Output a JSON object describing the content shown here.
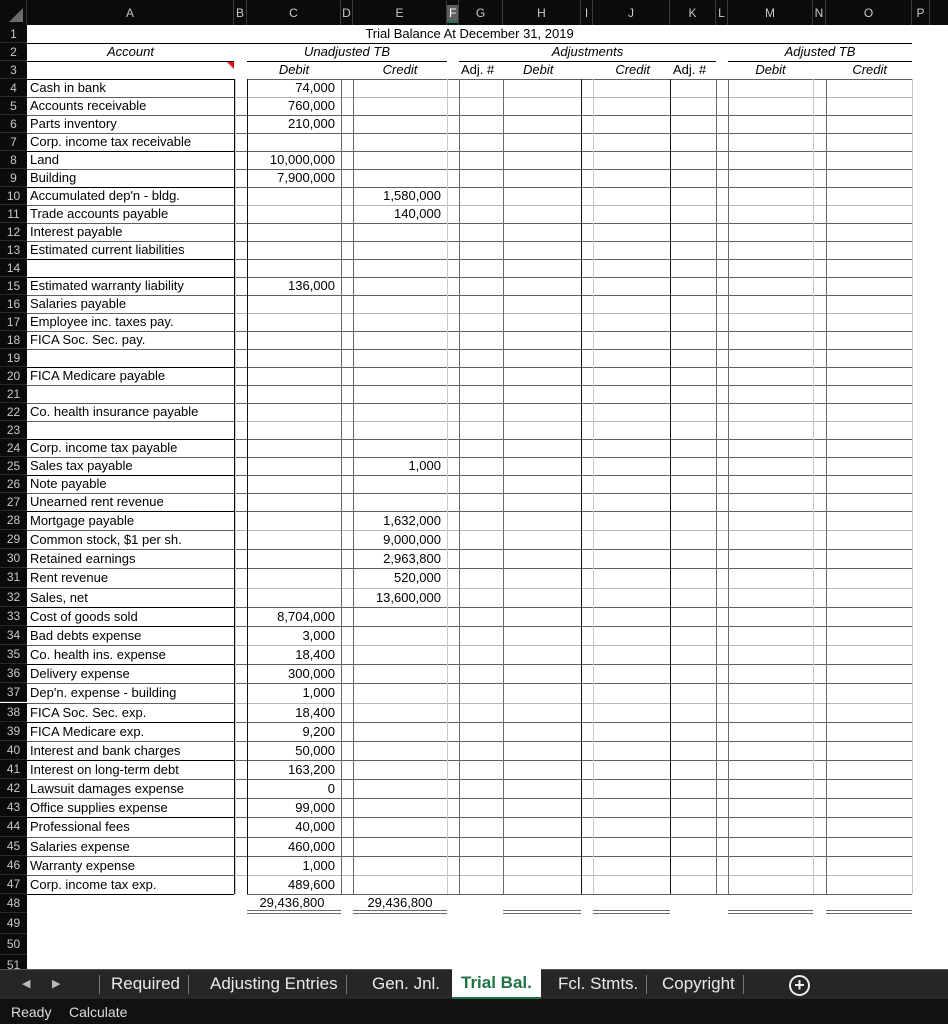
{
  "columns": [
    "A",
    "B",
    "C",
    "D",
    "E",
    "F",
    "G",
    "H",
    "I",
    "J",
    "K",
    "L",
    "M",
    "N",
    "O",
    "P"
  ],
  "selected_column": "F",
  "title": "Trial Balance At December 31, 2019",
  "headers": {
    "account": "Account",
    "unadjusted": "Unadjusted TB",
    "adjustments": "Adjustments",
    "adjusted": "Adjusted TB",
    "debit": "Debit",
    "credit": "Credit",
    "adj_no": "Adj. #"
  },
  "rows": [
    {
      "row": 4,
      "account": "Cash in bank",
      "debit": "74,000",
      "credit": ""
    },
    {
      "row": 5,
      "account": "Accounts receivable",
      "debit": "760,000",
      "credit": ""
    },
    {
      "row": 6,
      "account": "Parts inventory",
      "debit": "210,000",
      "credit": ""
    },
    {
      "row": 7,
      "account": "Corp. income tax receivable",
      "debit": "",
      "credit": ""
    },
    {
      "row": 8,
      "account": "Land",
      "debit": "10,000,000",
      "credit": ""
    },
    {
      "row": 9,
      "account": "Building",
      "debit": "7,900,000",
      "credit": ""
    },
    {
      "row": 10,
      "account": "Accumulated dep'n - bldg.",
      "debit": "",
      "credit": "1,580,000"
    },
    {
      "row": 11,
      "account": "Trade accounts payable",
      "debit": "",
      "credit": "140,000"
    },
    {
      "row": 12,
      "account": "Interest payable",
      "debit": "",
      "credit": ""
    },
    {
      "row": 13,
      "account": "Estimated current liabilities",
      "debit": "",
      "credit": ""
    },
    {
      "row": 14,
      "account": "",
      "debit": "",
      "credit": ""
    },
    {
      "row": 15,
      "account": "Estimated warranty liability",
      "debit": "136,000",
      "credit": ""
    },
    {
      "row": 16,
      "account": "Salaries payable",
      "debit": "",
      "credit": ""
    },
    {
      "row": 17,
      "account": "Employee inc. taxes pay.",
      "debit": "",
      "credit": ""
    },
    {
      "row": 18,
      "account": "FICA Soc. Sec. pay.",
      "debit": "",
      "credit": ""
    },
    {
      "row": 19,
      "account": "",
      "debit": "",
      "credit": ""
    },
    {
      "row": 20,
      "account": "FICA Medicare payable",
      "debit": "",
      "credit": ""
    },
    {
      "row": 21,
      "account": "",
      "debit": "",
      "credit": ""
    },
    {
      "row": 22,
      "account": "Co. health insurance payable",
      "debit": "",
      "credit": ""
    },
    {
      "row": 23,
      "account": "",
      "debit": "",
      "credit": ""
    },
    {
      "row": 24,
      "account": "Corp. income tax payable",
      "debit": "",
      "credit": ""
    },
    {
      "row": 25,
      "account": "Sales tax payable",
      "debit": "",
      "credit": "1,000"
    },
    {
      "row": 26,
      "account": "Note payable",
      "debit": "",
      "credit": ""
    },
    {
      "row": 27,
      "account": "Unearned rent revenue",
      "debit": "",
      "credit": ""
    },
    {
      "row": 28,
      "account": "Mortgage payable",
      "debit": "",
      "credit": "1,632,000"
    },
    {
      "row": 29,
      "account": "Common stock, $1 per sh.",
      "debit": "",
      "credit": "9,000,000"
    },
    {
      "row": 30,
      "account": "Retained earnings",
      "debit": "",
      "credit": "2,963,800"
    },
    {
      "row": 31,
      "account": "Rent revenue",
      "debit": "",
      "credit": "520,000"
    },
    {
      "row": 32,
      "account": "Sales, net",
      "debit": "",
      "credit": "13,600,000"
    },
    {
      "row": 33,
      "account": "Cost of goods sold",
      "debit": "8,704,000",
      "credit": ""
    },
    {
      "row": 34,
      "account": "Bad debts expense",
      "debit": "3,000",
      "credit": ""
    },
    {
      "row": 35,
      "account": "Co.  health ins. expense",
      "debit": "18,400",
      "credit": ""
    },
    {
      "row": 36,
      "account": "Delivery expense",
      "debit": "300,000",
      "credit": ""
    },
    {
      "row": 37,
      "account": "Dep'n. expense - building",
      "debit": "1,000",
      "credit": ""
    },
    {
      "row": 38,
      "account": "FICA Soc. Sec. exp.",
      "debit": "18,400",
      "credit": ""
    },
    {
      "row": 39,
      "account": "FICA Medicare exp.",
      "debit": "9,200",
      "credit": ""
    },
    {
      "row": 40,
      "account": "Interest and bank charges",
      "debit": "50,000",
      "credit": ""
    },
    {
      "row": 41,
      "account": "Interest on long-term debt",
      "debit": "163,200",
      "credit": ""
    },
    {
      "row": 42,
      "account": "Lawsuit damages expense",
      "debit": "0",
      "credit": ""
    },
    {
      "row": 43,
      "account": "Office supplies expense",
      "debit": "99,000",
      "credit": ""
    },
    {
      "row": 44,
      "account": "Professional fees",
      "debit": "40,000",
      "credit": ""
    },
    {
      "row": 45,
      "account": "Salaries expense",
      "debit": "460,000",
      "credit": ""
    },
    {
      "row": 46,
      "account": "Warranty expense",
      "debit": "1,000",
      "credit": ""
    },
    {
      "row": 47,
      "account": "Corp. income tax exp.",
      "debit": "489,600",
      "credit": ""
    }
  ],
  "totals": {
    "row": 48,
    "debit": "29,436,800",
    "credit": "29,436,800"
  },
  "extra_rows": [
    49,
    50,
    51
  ],
  "tabs": [
    {
      "label": "Required",
      "active": false
    },
    {
      "label": "Adjusting Entries",
      "active": false
    },
    {
      "label": "Gen. Jnl.",
      "active": false
    },
    {
      "label": "Trial Bal.",
      "active": true
    },
    {
      "label": "Fcl. Stmts.",
      "active": false
    },
    {
      "label": "Copyright",
      "active": false
    }
  ],
  "tab_nav": {
    "prev": "◀",
    "next": "▶",
    "add": "+"
  },
  "status": {
    "ready": "Ready",
    "calculate": "Calculate"
  },
  "colors": {
    "accent": "#217346",
    "comment_marker": "#e11111"
  }
}
